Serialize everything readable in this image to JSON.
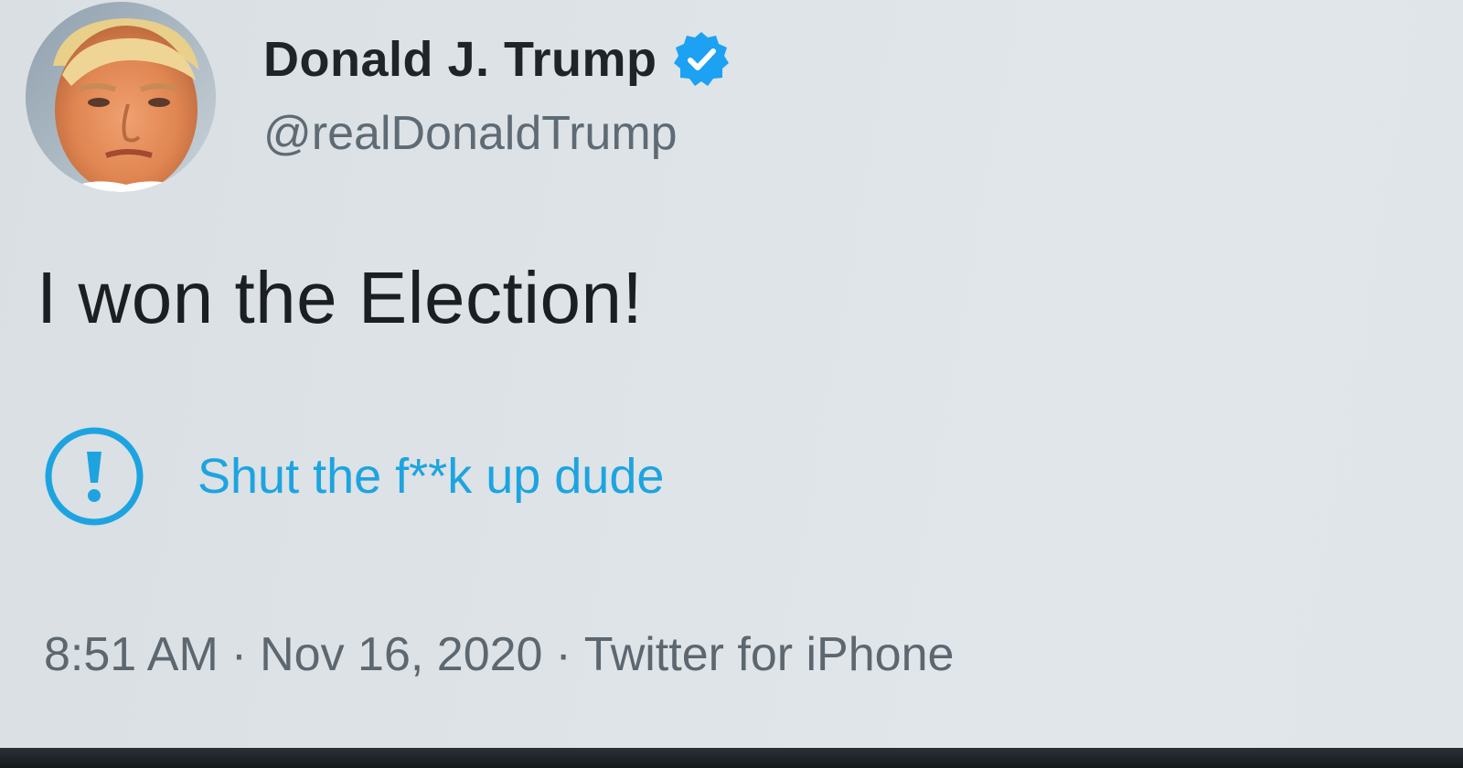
{
  "author": {
    "display_name": "Donald J. Trump",
    "handle": "@realDonaldTrump",
    "verified": true,
    "avatar_icon": "profile-photo",
    "verified_icon": "verified-badge-icon"
  },
  "tweet": {
    "text": "I won the Election!"
  },
  "notice": {
    "icon": "exclamation-circle-icon",
    "text": "Shut the f**k up dude"
  },
  "meta": {
    "time": "8:51 AM",
    "date": "Nov 16, 2020",
    "source": "Twitter for iPhone",
    "separator": "·"
  },
  "colors": {
    "background": "#dde3e7",
    "accent": "#1da1f2",
    "notice_text": "#1da4e0",
    "primary_text": "#1b1f22",
    "secondary_text": "#5f6b74"
  }
}
